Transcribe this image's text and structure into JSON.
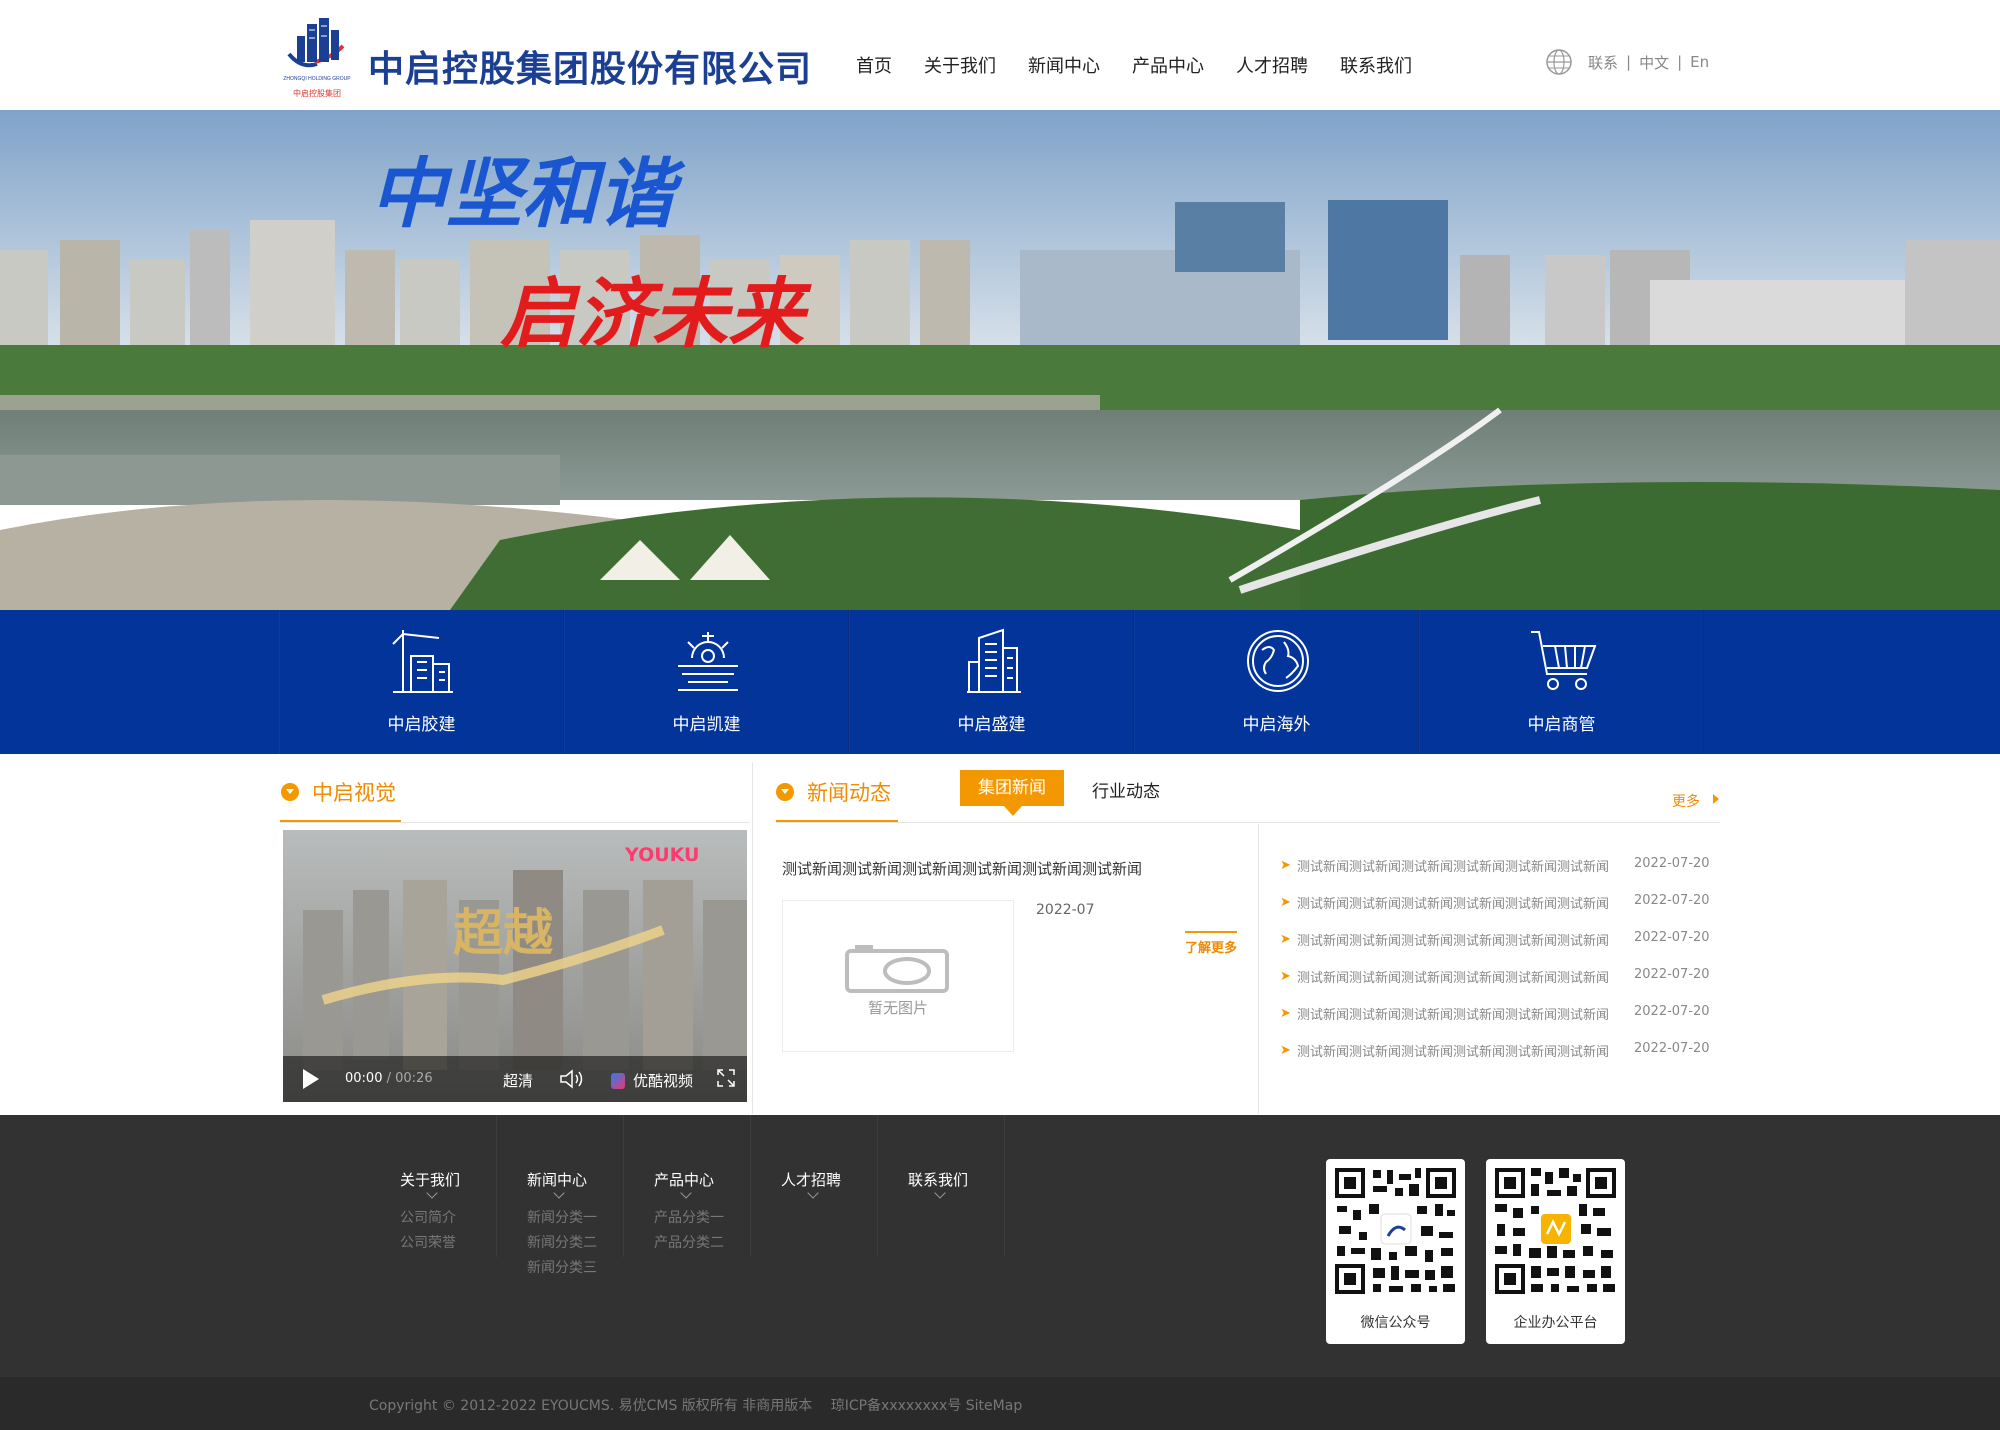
{
  "header": {
    "company_name": "中启控股集团股份有限公司",
    "logo_text": "中启控股集团",
    "logo_sub": "ZHONGQI HOLDING GROUP",
    "brand_color": "#1b3f92",
    "nav": [
      "首页",
      "关于我们",
      "新闻中心",
      "产品中心",
      "人才招聘",
      "联系我们"
    ],
    "lang": {
      "contact": "联系",
      "zh": "中文",
      "en": "En",
      "sep": "|"
    }
  },
  "banner": {
    "calligraphy_line1": "中坚和谐",
    "calligraphy_line2": "启济未来"
  },
  "strip": {
    "color": "#02349a",
    "items": [
      {
        "label": "中启胶建",
        "icon": "crane-building-icon"
      },
      {
        "label": "中启凯建",
        "icon": "gear-icon"
      },
      {
        "label": "中启盛建",
        "icon": "office-building-icon"
      },
      {
        "label": "中启海外",
        "icon": "globe-icon"
      },
      {
        "label": "中启商管",
        "icon": "shopping-cart-icon"
      }
    ]
  },
  "vision": {
    "title": "中启视觉",
    "video": {
      "logo": "YOUKU",
      "overlay_text": "超越",
      "time_current": "00:00",
      "time_total": "/ 00:26",
      "quality": "超清",
      "brand": "优酷视频"
    }
  },
  "news": {
    "title": "新闻动态",
    "tabs": [
      "集团新闻",
      "行业动态"
    ],
    "more": "更多",
    "accent": "#f39800",
    "feature": {
      "title": "测试新闻测试新闻测试新闻测试新闻测试新闻测试新闻",
      "date": "2022-07",
      "no_image": "暂无图片",
      "learn_more": "了解更多"
    },
    "list": [
      {
        "title": "测试新闻测试新闻测试新闻测试新闻测试新闻测试新闻",
        "date": "2022-07-20"
      },
      {
        "title": "测试新闻测试新闻测试新闻测试新闻测试新闻测试新闻",
        "date": "2022-07-20"
      },
      {
        "title": "测试新闻测试新闻测试新闻测试新闻测试新闻测试新闻",
        "date": "2022-07-20"
      },
      {
        "title": "测试新闻测试新闻测试新闻测试新闻测试新闻测试新闻",
        "date": "2022-07-20"
      },
      {
        "title": "测试新闻测试新闻测试新闻测试新闻测试新闻测试新闻",
        "date": "2022-07-20"
      },
      {
        "title": "测试新闻测试新闻测试新闻测试新闻测试新闻测试新闻",
        "date": "2022-07-20"
      }
    ]
  },
  "footer": {
    "columns": [
      {
        "title": "关于我们",
        "items": [
          "公司简介",
          "公司荣誉"
        ]
      },
      {
        "title": "新闻中心",
        "items": [
          "新闻分类一",
          "新闻分类二",
          "新闻分类三"
        ]
      },
      {
        "title": "产品中心",
        "items": [
          "产品分类一",
          "产品分类二"
        ]
      },
      {
        "title": "人才招聘",
        "items": []
      },
      {
        "title": "联系我们",
        "items": []
      }
    ],
    "qr": [
      {
        "label": "微信公众号"
      },
      {
        "label": "企业办公平台"
      }
    ],
    "copyright": "Copyright © 2012-2022 EYOUCMS. 易优CMS 版权所有 非商用版本 　琼ICP备xxxxxxxx号 SiteMap"
  }
}
